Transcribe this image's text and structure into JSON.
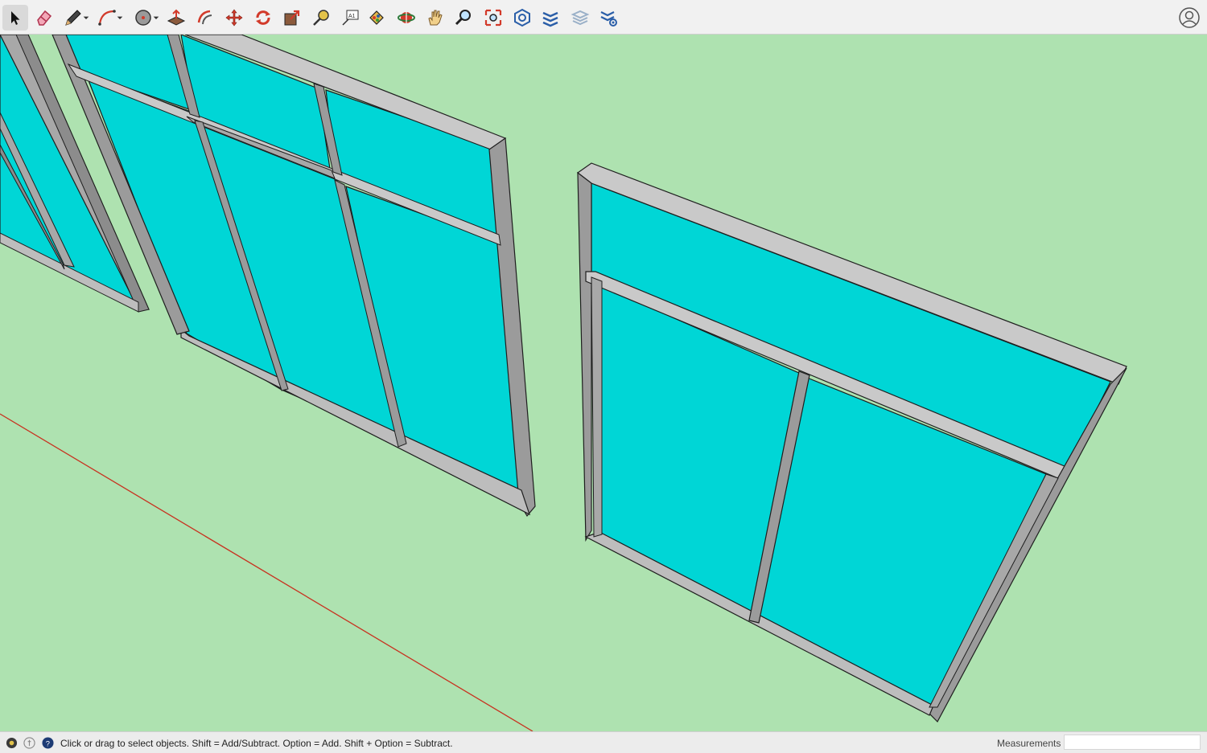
{
  "toolbar": {
    "tools": [
      {
        "name": "select-tool",
        "icon": "select-arrow-icon",
        "active": true
      },
      {
        "name": "eraser-tool",
        "icon": "eraser-icon"
      },
      {
        "name": "line-tool",
        "icon": "pencil-icon",
        "dropdown": true
      },
      {
        "name": "arc-tool",
        "icon": "arc-icon",
        "dropdown": true
      },
      {
        "name": "shape-tool",
        "icon": "circle-shape-icon",
        "dropdown": true
      },
      {
        "name": "push-pull-tool",
        "icon": "push-pull-icon"
      },
      {
        "name": "offset-tool",
        "icon": "offset-icon"
      },
      {
        "name": "move-tool",
        "icon": "move-icon"
      },
      {
        "name": "rotate-tool",
        "icon": "rotate-icon"
      },
      {
        "name": "scale-tool",
        "icon": "scale-icon"
      },
      {
        "name": "tape-measure-tool",
        "icon": "tape-measure-icon"
      },
      {
        "name": "text-tool",
        "icon": "text-label-icon"
      },
      {
        "name": "paint-bucket-tool",
        "icon": "paint-bucket-icon"
      },
      {
        "name": "orbit-tool",
        "icon": "orbit-icon"
      },
      {
        "name": "pan-tool",
        "icon": "hand-pan-icon"
      },
      {
        "name": "zoom-tool",
        "icon": "magnifier-icon"
      },
      {
        "name": "zoom-extents-tool",
        "icon": "zoom-extents-icon"
      },
      {
        "name": "3d-warehouse-tool",
        "icon": "warehouse-icon"
      },
      {
        "name": "extension-warehouse-tool",
        "icon": "extension-warehouse-icon"
      },
      {
        "name": "layout-tool",
        "icon": "layout-icon"
      },
      {
        "name": "extension-manager-tool",
        "icon": "extension-manager-icon"
      }
    ],
    "account_icon": "user-account-icon"
  },
  "colors": {
    "ground": "#aee2b0",
    "glass": "#00d6d6",
    "frame_top": "#c9c9c9",
    "frame_side": "#9b9b9b",
    "outline": "#1e1e1e",
    "red_axis": "#c8311f",
    "accent_blue": "#2a5ea8"
  },
  "status": {
    "message": "Click or drag to select objects. Shift = Add/Subtract. Option = Add. Shift + Option = Subtract.",
    "measurements_label": "Measurements",
    "measurements_value": ""
  }
}
